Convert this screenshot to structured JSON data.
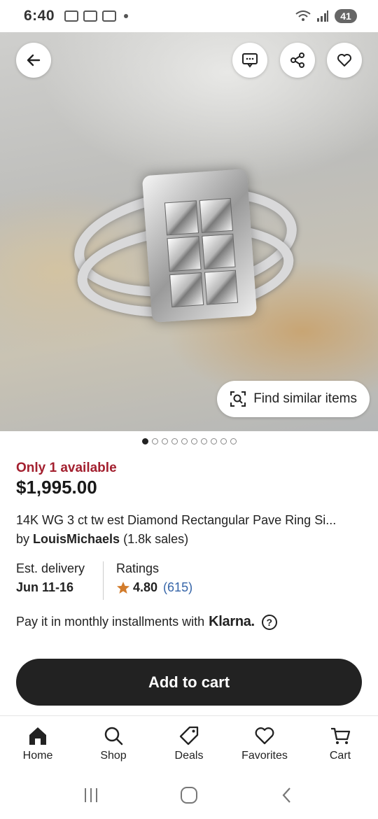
{
  "status_bar": {
    "time": "6:40",
    "battery": "41"
  },
  "hero": {
    "find_similar_label": "Find similar items",
    "image_count": 10,
    "active_index": 0
  },
  "listing": {
    "availability": "Only 1 available",
    "price": "$1,995.00",
    "title": "14K WG 3 ct tw est Diamond Rectangular Pave Ring Si...",
    "seller_prefix": "by",
    "seller_name": "LouisMichaels",
    "seller_sales": "(1.8k sales)"
  },
  "delivery": {
    "label": "Est. delivery",
    "value": "Jun 11-16"
  },
  "ratings": {
    "label": "Ratings",
    "score": "4.80",
    "count": "(615)",
    "star_color": "#d27c2c"
  },
  "klarna": {
    "text": "Pay it in monthly installments with",
    "brand": "Klarna."
  },
  "cta": {
    "add_to_cart": "Add to cart"
  },
  "bottom_nav": {
    "home": "Home",
    "shop": "Shop",
    "deals": "Deals",
    "favorites": "Favorites",
    "cart": "Cart"
  }
}
